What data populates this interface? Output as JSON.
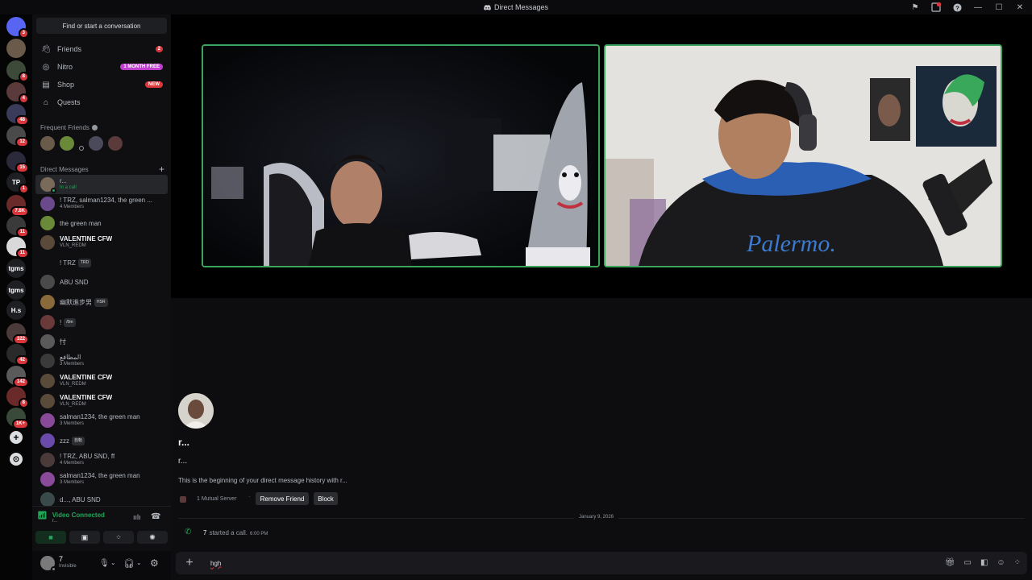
{
  "window": {
    "title": "Direct Messages"
  },
  "rail": {
    "servers": [
      {
        "label": "",
        "badge": "3",
        "color": "#5865f2"
      },
      {
        "label": "",
        "badge": "",
        "color": "#6a5a4a"
      },
      {
        "label": "",
        "badge": "8",
        "color": "#3d4a3a"
      },
      {
        "label": "",
        "badge": "4",
        "color": "#5a3a3a"
      },
      {
        "label": "",
        "badge": "48",
        "color": "#3a3a5a"
      },
      {
        "label": "",
        "badge": "12",
        "color": "#4a4a4a"
      },
      {
        "label": "",
        "badge": "15",
        "color": "#2a2a3a"
      },
      {
        "label": "TP",
        "badge": "1",
        "color": "#1e1f22"
      },
      {
        "label": "",
        "badge": "7.8K",
        "color": "#6a2a2a"
      },
      {
        "label": "",
        "badge": "11",
        "color": "#3a3a3a"
      },
      {
        "label": "",
        "badge": "11",
        "color": "#d9d9d9"
      },
      {
        "label": "tgms",
        "badge": "",
        "color": "#1e1f22"
      },
      {
        "label": "tgms",
        "badge": "",
        "color": "#1e1f22"
      },
      {
        "label": "H.s",
        "badge": "",
        "color": "#1e1f22"
      },
      {
        "label": "",
        "badge": "322",
        "color": "#4a3a3a"
      },
      {
        "label": "",
        "badge": "42",
        "color": "#2a2a2a"
      },
      {
        "label": "",
        "badge": "142",
        "color": "#5a5a5a"
      },
      {
        "label": "",
        "badge": "8",
        "color": "#6a2a2a"
      },
      {
        "label": "",
        "badge": "1K+",
        "color": "#3a4a3a"
      }
    ],
    "add_label": "+",
    "discover_label": "⊙"
  },
  "sidebar": {
    "search_placeholder": "Find or start a conversation",
    "nav": [
      {
        "label": "Friends",
        "badge": "2",
        "badge_color": "#da373c"
      },
      {
        "label": "Nitro",
        "badge": "1 MONTH FREE",
        "badge_color": "#c03fd0"
      },
      {
        "label": "Shop",
        "badge": "NEW",
        "badge_color": "#da373c"
      },
      {
        "label": "Quests",
        "badge": "",
        "badge_color": ""
      }
    ],
    "frequent_friends_label": "Frequent Friends",
    "direct_messages_label": "Direct Messages",
    "add_dm_label": "+",
    "dms": [
      {
        "name": "r...",
        "sub": "In a call",
        "bold": false,
        "active": true,
        "color": "#7a6a5a",
        "status": "#23a55a",
        "tag": ""
      },
      {
        "name": "! TRZ, salman1234, the green ...",
        "sub": "4 Members",
        "bold": false,
        "active": false,
        "color": "#6a4a8a",
        "status": "",
        "tag": ""
      },
      {
        "name": "the green man",
        "sub": "",
        "bold": false,
        "active": false,
        "color": "#6a8a3a",
        "status": "",
        "tag": ""
      },
      {
        "name": "VALENTINE CFW",
        "sub": "VLN_REDM",
        "bold": true,
        "active": false,
        "color": "#5a4a3a",
        "status": "",
        "tag": ""
      },
      {
        "name": "! TRZ",
        "sub": "",
        "bold": false,
        "active": false,
        "color": "#0f0f11",
        "status": "",
        "tag": "TRD"
      },
      {
        "name": "ABU SND",
        "sub": "",
        "bold": false,
        "active": false,
        "color": "#4a4a4a",
        "status": "",
        "tag": ""
      },
      {
        "name": "幽默進步男",
        "sub": "",
        "bold": false,
        "active": false,
        "color": "#8a6a3a",
        "status": "",
        "tag": "HSR"
      },
      {
        "name": "!",
        "sub": "",
        "bold": false,
        "active": false,
        "color": "#6a3a3a",
        "status": "",
        "tag": "/0m"
      },
      {
        "name": "忖",
        "sub": "",
        "bold": false,
        "active": false,
        "color": "#5a5a5a",
        "status": "",
        "tag": ""
      },
      {
        "name": "المطافع",
        "sub": "3 Members",
        "bold": false,
        "active": false,
        "color": "#3a3a3a",
        "status": "",
        "tag": ""
      },
      {
        "name": "VALENTINE CFW",
        "sub": "VLN_REDM",
        "bold": true,
        "active": false,
        "color": "#5a4a3a",
        "status": "",
        "tag": ""
      },
      {
        "name": "VALENTINE CFW",
        "sub": "VLN_REDM",
        "bold": true,
        "active": false,
        "color": "#5a4a3a",
        "status": "",
        "tag": ""
      },
      {
        "name": "salman1234, the green man",
        "sub": "3 Members",
        "bold": false,
        "active": false,
        "color": "#8a4a9a",
        "status": "",
        "tag": ""
      },
      {
        "name": "zzz",
        "sub": "",
        "bold": false,
        "active": false,
        "color": "#6a4aaa",
        "status": "",
        "tag": "自転"
      },
      {
        "name": "! TRZ, ABU SND, ff",
        "sub": "4 Members",
        "bold": false,
        "active": false,
        "color": "#4a3a3a",
        "status": "",
        "tag": ""
      },
      {
        "name": "salman1234, the green man",
        "sub": "3 Members",
        "bold": false,
        "active": false,
        "color": "#8a4a9a",
        "status": "",
        "tag": ""
      },
      {
        "name": "d..., ABU SND",
        "sub": "",
        "bold": false,
        "active": false,
        "color": "#3a4a4a",
        "status": "",
        "tag": ""
      }
    ]
  },
  "voice": {
    "status": "Video Connected",
    "channel": "r..."
  },
  "user": {
    "name": "7",
    "status": "Invisible"
  },
  "chat": {
    "name": "r...",
    "username": "r...",
    "intro": "This is the beginning of your direct message history with r...",
    "mutual": "1 Mutual Server",
    "remove_friend": "Remove Friend",
    "block": "Block",
    "date": "January 9, 2026",
    "call_user": "7",
    "call_text": "started a call.",
    "call_time": "6:00 PM",
    "composer_value": "hgh"
  },
  "video": {
    "left_shirt_text": "",
    "right_shirt_text": "Palermo."
  },
  "colors": {
    "accent": "#5865f2",
    "call_green": "#3ba55c",
    "mention": "#da373c"
  }
}
